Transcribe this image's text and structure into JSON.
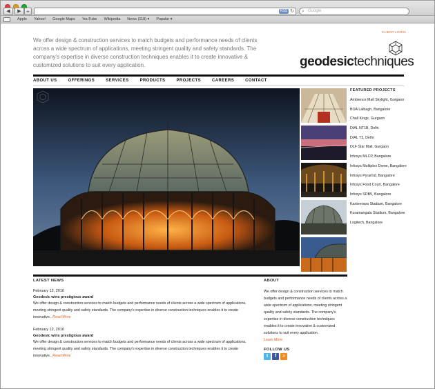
{
  "browser": {
    "search_placeholder": "Google",
    "rss_label": "RSS",
    "bookmarks": [
      "Apple",
      "Yahoo!",
      "Google Maps",
      "YouTube",
      "Wikipedia",
      "News (118) ▾",
      "Popular ▾"
    ]
  },
  "header": {
    "client_login": "CLIENT LOGIN",
    "tagline": "We offer design & construction services to match budgets and performance needs of clients across a wide spectrum of applications, meeting stringent quality and safety standards. The company's expertise in diverse construction techniques enables it to create innovative & customized solutions to suit every application.",
    "logo_bold": "geodesic",
    "logo_light": "techniques"
  },
  "nav": [
    "ABOUT US",
    "OFFERINGS",
    "SERVICES",
    "PRODUCTS",
    "PROJECTS",
    "CAREERS",
    "CONTACT"
  ],
  "featured": {
    "title": "FEATURED PROJECTS",
    "items": [
      "Ambience Mall Skylight, Gurgaon",
      "BOA Lalbagh, Bangalore",
      "Chall Kings, Gurgaon",
      "DIAL NT1B, Delhi",
      "DIAL T3, Delhi",
      "DLF Star Mall, Gurgaon",
      "Infosys MLCP, Bangalore",
      "Infosys Multiplex Dome, Bangalore",
      "Infosys Pyramid, Bangalore",
      "Infosys Food Court, Bangalore",
      "Infosys SDB5, Bangalore",
      "Kanteerava Stadium, Bangalore",
      "Koramangala Stadium, Bangalore",
      "Logitech, Bangalore"
    ]
  },
  "news": {
    "title": "LATEST NEWS",
    "items": [
      {
        "date": "February 12, 2010",
        "headline": "Geodesic wins prestigious award",
        "body": "We offer design & construction services to match budgets and performance needs of clients across a wide spectrum of applications, meeting stringent quality and safety standards. The company's expertise in diverse construction techniques enables it to create innovative..",
        "read_more": "Read More"
      },
      {
        "date": "February 12, 2010",
        "headline": "Geodesic wins prestigious award",
        "body": "We offer design & construction services to match budgets and performance needs of clients across a wide spectrum of applications, meeting stringent quality and safety standards. The company's expertise in diverse construction techniques enables it to create innovative..",
        "read_more": "Read More"
      }
    ]
  },
  "about": {
    "title": "ABOUT",
    "body": "We offer design & construction services to match budgets and performance needs of clients across a wide spectrum of applications, meeting stringent quality and safety standards. The company's expertise in diverse construction techniques enables it to create innovative & customized solutions to suit every application.",
    "learn_more": "Learn More",
    "follow_title": "FOLLOW US"
  },
  "colors": {
    "accent": "#e05a1e",
    "rule": "#111111"
  }
}
